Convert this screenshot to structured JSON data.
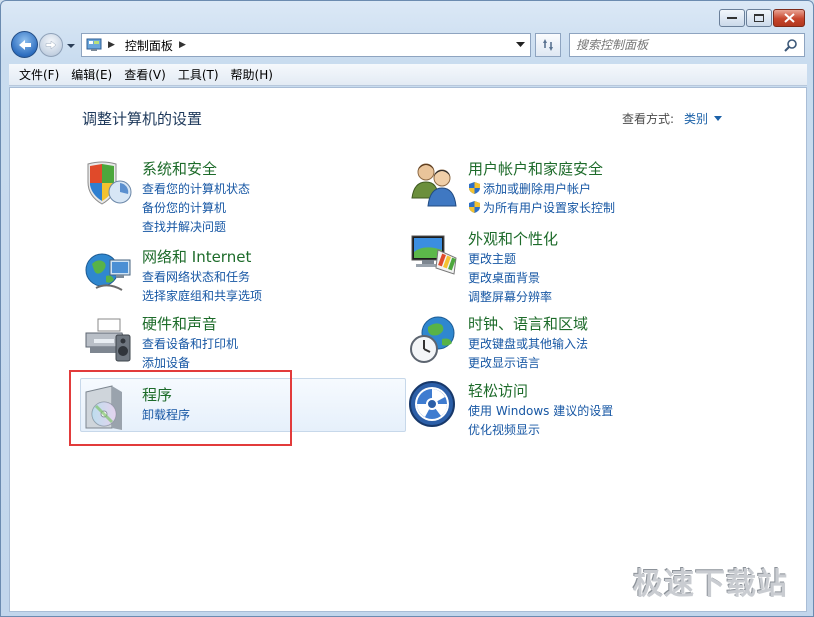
{
  "address": {
    "segments": [
      "控制面板"
    ],
    "search_placeholder": "搜索控制面板"
  },
  "menu": [
    "文件(F)",
    "编辑(E)",
    "查看(V)",
    "工具(T)",
    "帮助(H)"
  ],
  "page": {
    "title": "调整计算机的设置",
    "view_by_label": "查看方式:",
    "view_by_value": "类别"
  },
  "categories": [
    {
      "title": "系统和安全",
      "icon": "shield-computer-icon",
      "links": [
        "查看您的计算机状态",
        "备份您的计算机",
        "查找并解决问题"
      ]
    },
    {
      "title": "网络和 Internet",
      "icon": "network-globe-icon",
      "links": [
        "查看网络状态和任务",
        "选择家庭组和共享选项"
      ]
    },
    {
      "title": "硬件和声音",
      "icon": "printer-speaker-icon",
      "links": [
        "查看设备和打印机",
        "添加设备"
      ]
    },
    {
      "title": "程序",
      "icon": "programs-disc-icon",
      "links": [
        "卸载程序"
      ]
    },
    {
      "title": "用户帐户和家庭安全",
      "icon": "users-icon",
      "links": [
        "添加或删除用户帐户",
        "为所有用户设置家长控制"
      ]
    },
    {
      "title": "外观和个性化",
      "icon": "monitor-palette-icon",
      "links": [
        "更改主题",
        "更改桌面背景",
        "调整屏幕分辨率"
      ]
    },
    {
      "title": "时钟、语言和区域",
      "icon": "clock-globe-icon",
      "links": [
        "更改键盘或其他输入法",
        "更改显示语言"
      ]
    },
    {
      "title": "轻松访问",
      "icon": "ease-of-access-icon",
      "links": [
        "使用 Windows 建议的设置",
        "优化视频显示"
      ]
    }
  ],
  "watermark": "极速下载站",
  "colors": {
    "category_title": "#1d6b2a",
    "link": "#1757a4",
    "page_title": "#1e395b",
    "highlight": "#e23b3b"
  }
}
